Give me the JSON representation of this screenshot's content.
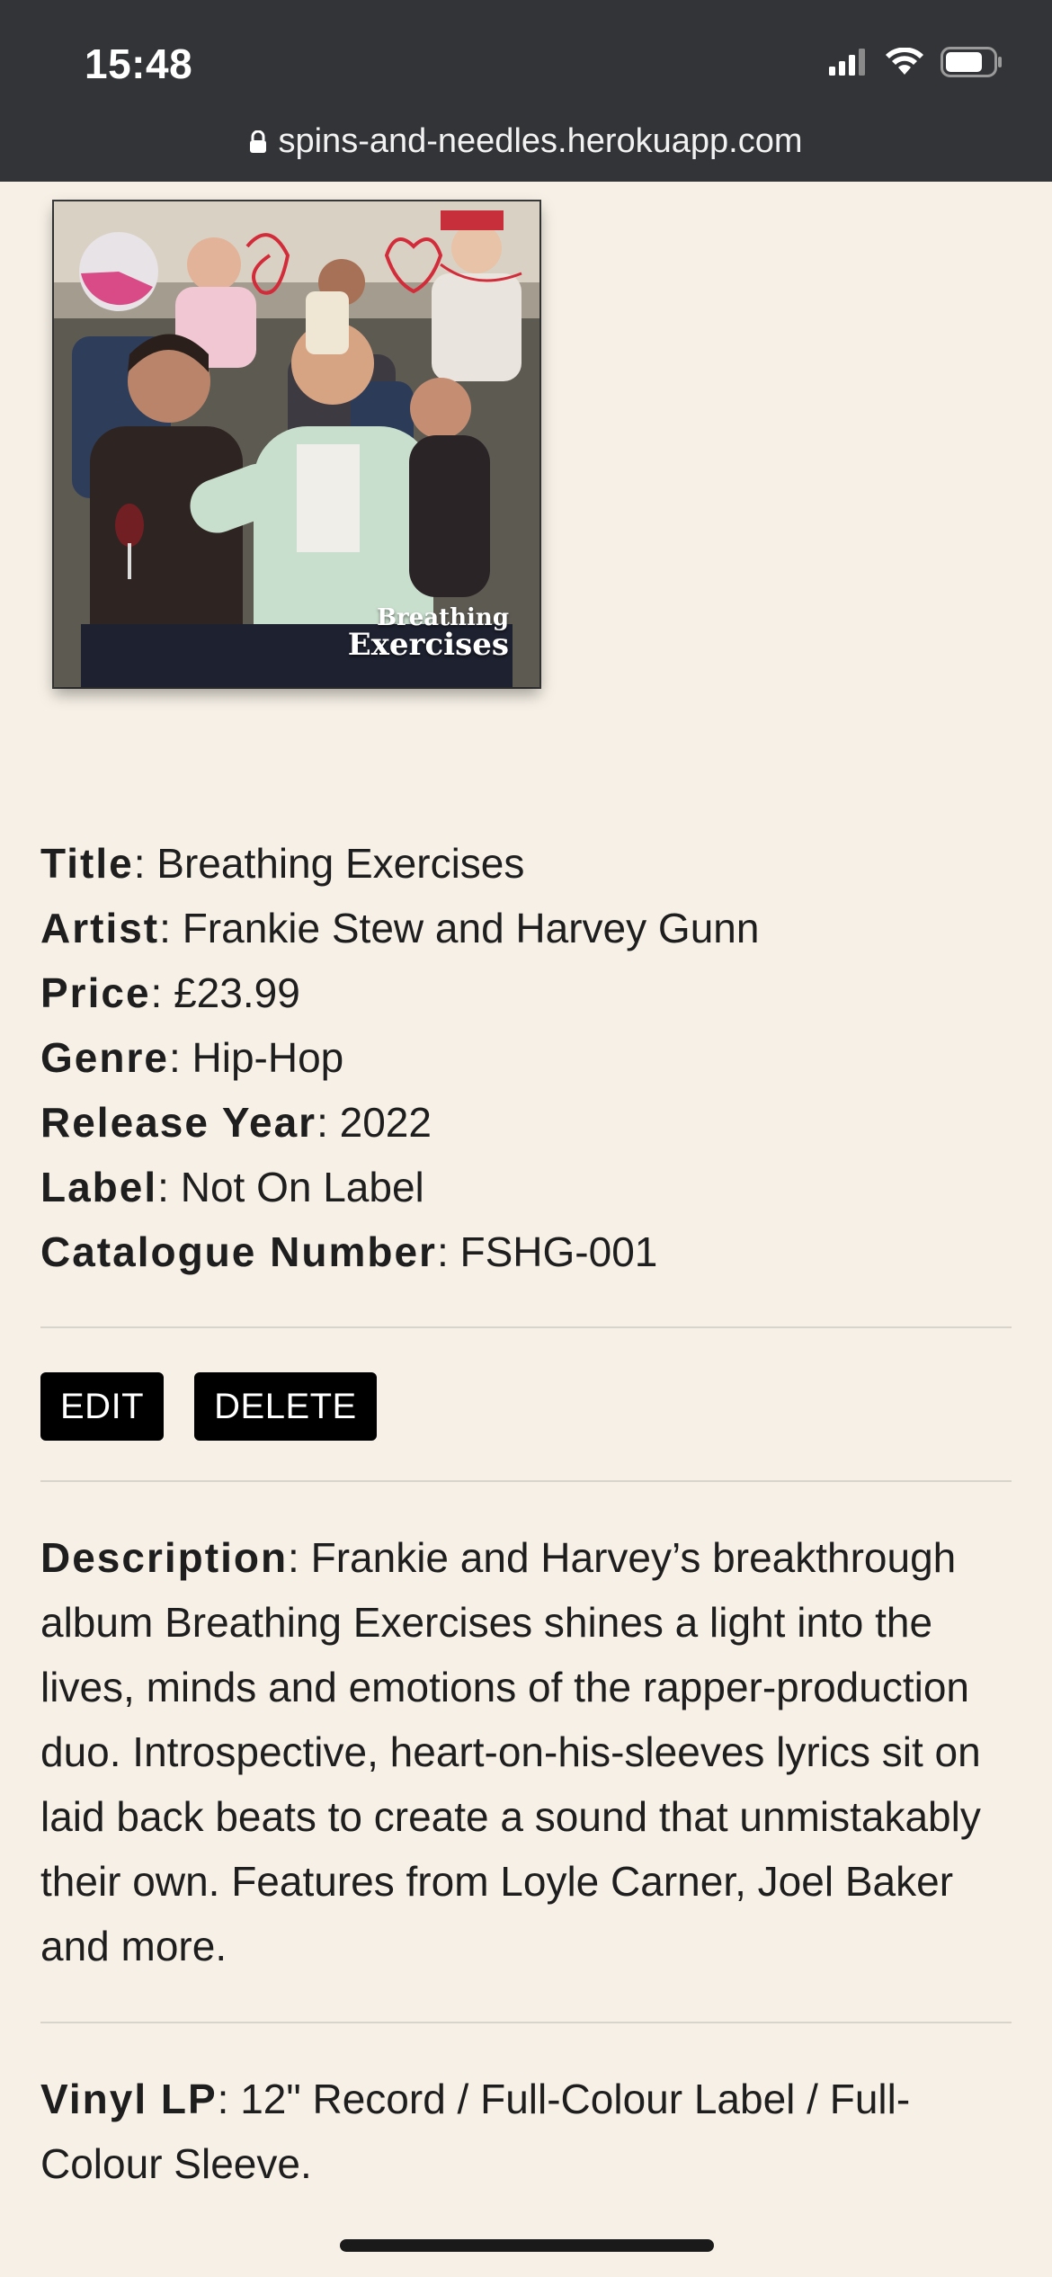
{
  "status_bar": {
    "time": "15:48"
  },
  "browser": {
    "url": "spins-and-needles.herokuapp.com"
  },
  "cover": {
    "title_line1": "Breathing",
    "title_line2": "Exercises"
  },
  "details": {
    "title": {
      "label": "Title",
      "value": "Breathing Exercises"
    },
    "artist": {
      "label": "Artist",
      "value": "Frankie Stew and Harvey Gunn"
    },
    "price": {
      "label": "Price",
      "value": "£23.99"
    },
    "genre": {
      "label": "Genre",
      "value": "Hip-Hop"
    },
    "release_year": {
      "label": "Release Year",
      "value": "2022"
    },
    "record_label": {
      "label": "Label",
      "value": "Not On Label"
    },
    "catalogue_number": {
      "label": "Catalogue Number",
      "value": "FSHG-001"
    }
  },
  "actions": {
    "edit_label": "EDIT",
    "delete_label": "DELETE"
  },
  "description": {
    "label": "Description",
    "text": "Frankie and Harvey’s breakthrough album Breathing Exercises shines a light into the lives, minds and emotions of the rapper-production duo. Introspective, heart-on-his-sleeves lyrics sit on laid back beats to create a sound that unmistakably their own. Features from Loyle Carner, Joel Baker and more."
  },
  "format": {
    "label": "Vinyl LP",
    "text": "12\" Record / Full-Colour Label / Full-Colour Sleeve."
  },
  "colors": {
    "page_background": "#f6f0e6",
    "top_bar": "#333437",
    "button_background": "#000000",
    "button_text": "#ffffff"
  }
}
